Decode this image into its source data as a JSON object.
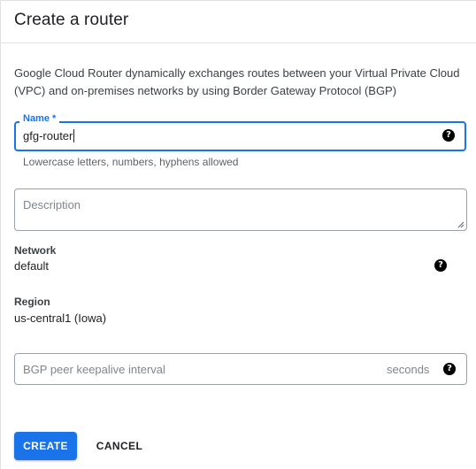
{
  "dialog": {
    "title": "Create a router",
    "intro": "Google Cloud Router dynamically exchanges routes between your Virtual Private Cloud (VPC) and on-premises networks by using Border Gateway Protocol (BGP)"
  },
  "name_field": {
    "label": "Name *",
    "value": "gfg-router",
    "hint": "Lowercase letters, numbers, hyphens allowed",
    "help_icon": "help-icon"
  },
  "description_field": {
    "placeholder": "Description"
  },
  "network": {
    "label": "Network",
    "value": "default",
    "help_icon": "help-icon"
  },
  "region": {
    "label": "Region",
    "value": "us-central1 (Iowa)"
  },
  "bgp_field": {
    "placeholder": "BGP peer keepalive interval",
    "suffix": "seconds",
    "help_icon": "help-icon"
  },
  "actions": {
    "create_label": "CREATE",
    "cancel_label": "CANCEL"
  },
  "colors": {
    "accent": "#1a73e8",
    "text": "#202124",
    "muted": "#5f6368"
  }
}
